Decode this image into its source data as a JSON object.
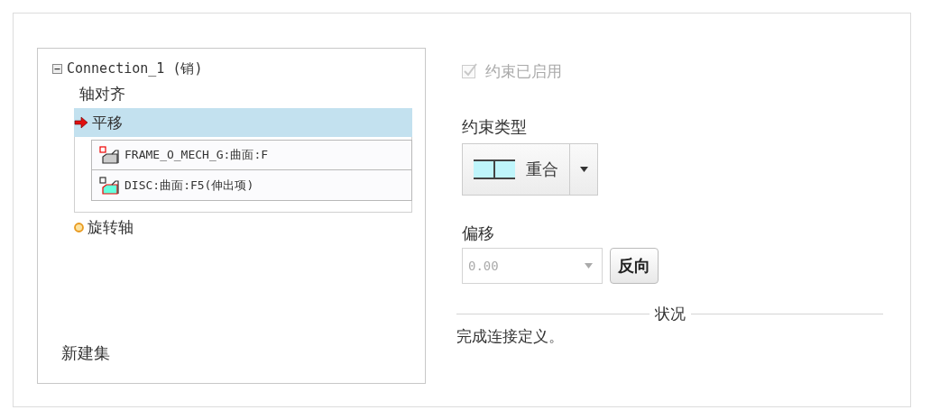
{
  "tree": {
    "label": "Connection_1 (销)",
    "expanded": true,
    "children": [
      {
        "label": "轴对齐",
        "kind": "plain",
        "selected": false
      },
      {
        "label": "平移",
        "kind": "arrow",
        "selected": true,
        "references": [
          "FRAME_O_MECH_G:曲面:F",
          "DISC:曲面:F5(伸出项)"
        ]
      },
      {
        "label": "旋转轴",
        "kind": "dot",
        "selected": false
      }
    ]
  },
  "new_set": "新建集",
  "constraint_enabled": {
    "label": "约束已启用",
    "checked": true,
    "disabled": true
  },
  "constraint_type": {
    "label": "约束类型",
    "value": "重合"
  },
  "offset": {
    "label": "偏移",
    "value": "0.00",
    "disabled": true
  },
  "flip_button": "反向",
  "status": {
    "title": "状况",
    "message": "完成连接定义。"
  }
}
